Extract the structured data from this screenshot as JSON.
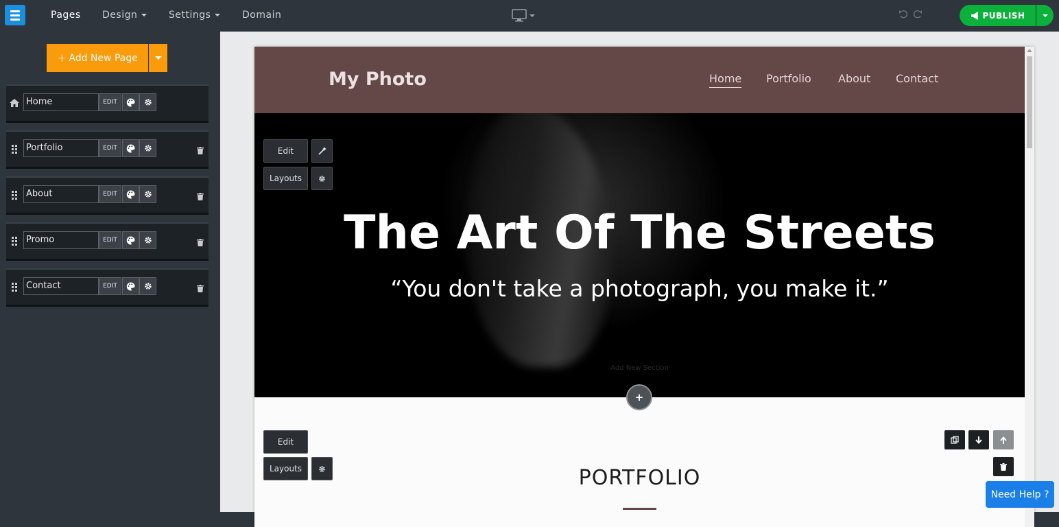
{
  "topbar": {
    "nav": [
      "Pages",
      "Design",
      "Settings",
      "Domain"
    ],
    "publish_label": "PUBLISH"
  },
  "sidebar": {
    "add_page_label": "Add New Page",
    "edit_label": "EDIT",
    "pages": [
      {
        "name": "Home"
      },
      {
        "name": "Portfolio"
      },
      {
        "name": "About"
      },
      {
        "name": "Promo"
      },
      {
        "name": "Contact"
      }
    ]
  },
  "site": {
    "title": "My Photo",
    "nav": [
      "Home",
      "Portfolio",
      "About",
      "Contact"
    ],
    "hero_title": "The Art Of The Streets",
    "hero_subtitle": "“You don't take a photograph, you make it.”",
    "add_section_label": "Add New Section",
    "section_title": "PORTFOLIO"
  },
  "editor": {
    "edit_label": "Edit",
    "layouts_label": "Layouts"
  },
  "help_label": "Need Help ?",
  "colors": {
    "publish": "#0cb13c",
    "add_page": "#f99b0a",
    "header_bg": "#644747",
    "help": "#1a7fe8"
  }
}
